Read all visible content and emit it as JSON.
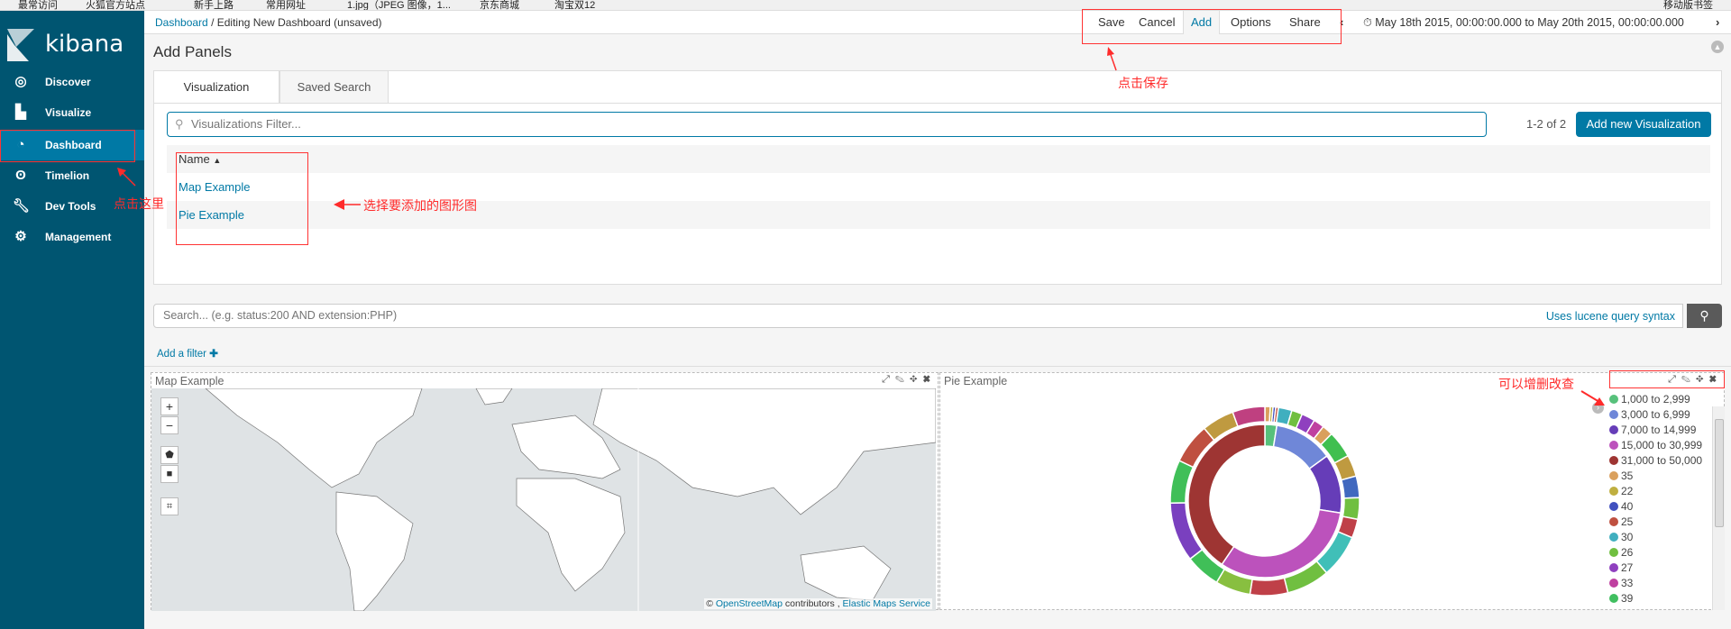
{
  "bookmarks": [
    "最常访问",
    "火狐官方站点",
    "新手上路",
    "常用网址",
    "1.jpg（JPEG 图像，1...",
    "京东商城",
    "淘宝双12",
    "移动版书签"
  ],
  "app": {
    "logo": "kibana"
  },
  "sidebar": {
    "items": [
      {
        "label": "Discover",
        "icon": "compass-icon"
      },
      {
        "label": "Visualize",
        "icon": "bar-chart-icon"
      },
      {
        "label": "Dashboard",
        "icon": "dashboard-icon",
        "active": true
      },
      {
        "label": "Timelion",
        "icon": "bear-icon"
      },
      {
        "label": "Dev Tools",
        "icon": "wrench-icon"
      },
      {
        "label": "Management",
        "icon": "gear-icon"
      }
    ]
  },
  "topbar": {
    "breadcrumb_link": "Dashboard",
    "breadcrumb_sep": "/",
    "breadcrumb_current": "Editing New Dashboard (unsaved)",
    "save": "Save",
    "cancel": "Cancel",
    "add": "Add",
    "options": "Options",
    "share": "Share",
    "time_range": "May 18th 2015, 00:00:00.000 to May 20th 2015, 00:00:00.000"
  },
  "annotations": {
    "save_hint": "点击保存",
    "dashboard_hint": "点击这里",
    "select_hint": "选择要添加的图形图",
    "edit_hint": "可以增删改查",
    "color": "#ff2b2b"
  },
  "add_panels": {
    "title": "Add Panels",
    "tabs": [
      "Visualization",
      "Saved Search"
    ],
    "filter_placeholder": "Visualizations Filter...",
    "count": "1-2 of 2",
    "add_new": "Add new Visualization",
    "column": "Name",
    "rows": [
      "Map Example",
      "Pie Example"
    ]
  },
  "query": {
    "placeholder": "Search... (e.g. status:200 AND extension:PHP)",
    "syntax_link": "Uses lucene query syntax",
    "add_filter": "Add a filter"
  },
  "panels": {
    "map": {
      "title": "Map Example",
      "attr_osm": "OpenStreetMap",
      "attr_contrib": "contributors ,",
      "attr_ems": "Elastic Maps Service",
      "attr_copy": "©"
    },
    "pie": {
      "title": "Pie Example"
    }
  },
  "chart_data": {
    "type": "pie",
    "legend": [
      {
        "label": "1,000 to 2,999",
        "color": "#57c17b"
      },
      {
        "label": "3,000 to 6,999",
        "color": "#6f87d8"
      },
      {
        "label": "7,000 to 14,999",
        "color": "#663db8"
      },
      {
        "label": "15,000 to 30,999",
        "color": "#bc52bc"
      },
      {
        "label": "31,000 to 50,000",
        "color": "#9e3533"
      },
      {
        "label": "35",
        "color": "#daa05d"
      },
      {
        "label": "22",
        "color": "#bfaf40"
      },
      {
        "label": "40",
        "color": "#4050bf"
      },
      {
        "label": "25",
        "color": "#bf5040"
      },
      {
        "label": "30",
        "color": "#40afbf"
      },
      {
        "label": "26",
        "color": "#70bf40"
      },
      {
        "label": "27",
        "color": "#8f40bf"
      },
      {
        "label": "33",
        "color": "#bf40a0"
      },
      {
        "label": "39",
        "color": "#40bf60"
      }
    ],
    "inner": [
      {
        "label": "1,000 to 2,999",
        "value": 2.5
      },
      {
        "label": "3,000 to 6,999",
        "value": 12.5
      },
      {
        "label": "7,000 to 14,999",
        "value": 12.5
      },
      {
        "label": "15,000 to 30,999",
        "value": 32
      },
      {
        "label": "31,000 to 50,000",
        "value": 40.5
      }
    ],
    "outer": [
      {
        "value": 1,
        "color": "#daa05d"
      },
      {
        "value": 0.5,
        "color": "#bfaf40"
      },
      {
        "value": 0.5,
        "color": "#4050bf"
      },
      {
        "value": 0.5,
        "color": "#bf5040"
      },
      {
        "value": 2.5,
        "color": "#40afbf"
      },
      {
        "value": 2,
        "color": "#70bf40"
      },
      {
        "value": 2.5,
        "color": "#8f40bf"
      },
      {
        "value": 2,
        "color": "#bf40a0"
      },
      {
        "value": 2,
        "color": "#daa05d"
      },
      {
        "value": 5,
        "color": "#40bf50"
      },
      {
        "value": 4,
        "color": "#bf9a40"
      },
      {
        "value": 4,
        "color": "#4068bf"
      },
      {
        "value": 4,
        "color": "#70bf40"
      },
      {
        "value": 3.5,
        "color": "#bf4048"
      },
      {
        "value": 8,
        "color": "#40bfb8"
      },
      {
        "value": 8,
        "color": "#70bf40"
      },
      {
        "value": 7,
        "color": "#bf4048"
      },
      {
        "value": 6.5,
        "color": "#88bf40"
      },
      {
        "value": 6.5,
        "color": "#40bf58"
      },
      {
        "value": 11,
        "color": "#7a40bf"
      },
      {
        "value": 8,
        "color": "#40bf58"
      },
      {
        "value": 7.5,
        "color": "#bf5040"
      },
      {
        "value": 6,
        "color": "#bf9a40"
      },
      {
        "value": 6,
        "color": "#bf4080"
      }
    ]
  }
}
